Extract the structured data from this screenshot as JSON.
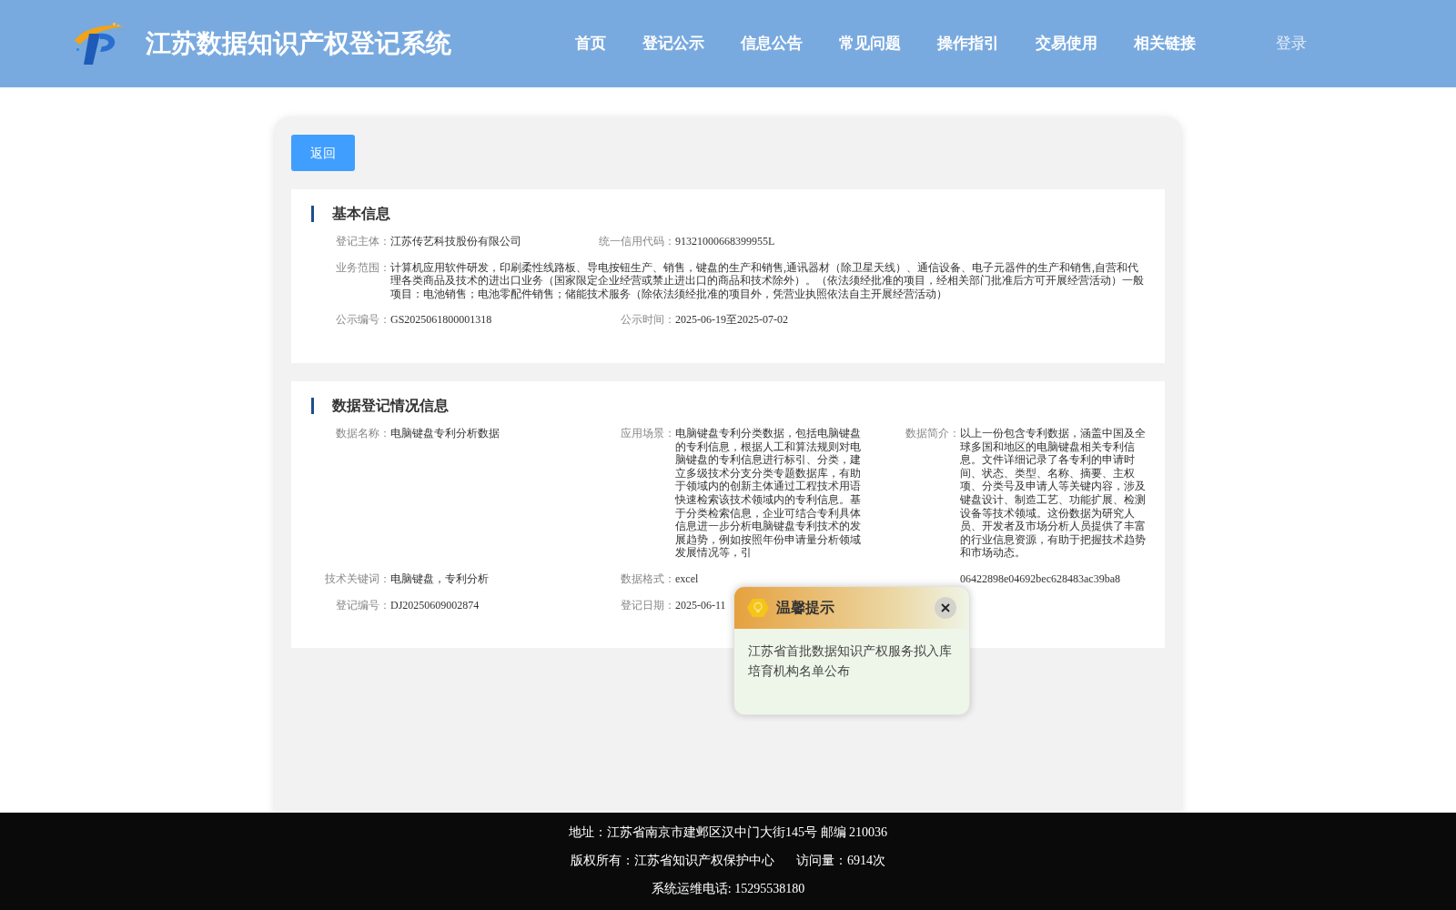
{
  "header": {
    "title": "江苏数据知识产权登记系统",
    "nav": [
      "首页",
      "登记公示",
      "信息公告",
      "常见问题",
      "操作指引",
      "交易使用",
      "相关链接"
    ],
    "login": "登录"
  },
  "back_button": "返回",
  "sections": [
    {
      "title": "基本信息",
      "rows": [
        [
          {
            "label": "登记主体：",
            "value": "江苏传艺科技股份有限公司"
          },
          {
            "label": "统一信用代码：",
            "value": "91321000668399955L"
          }
        ],
        [
          {
            "label": "业务范围：",
            "value": "计算机应用软件研发，印刷柔性线路板、导电按钮生产、销售，键盘的生产和销售,通讯器材（除卫星天线）、通信设备、电子元器件的生产和销售,自营和代理各类商品及技术的进出口业务（国家限定企业经营或禁止进出口的商品和技术除外）。（依法须经批准的项目，经相关部门批准后方可开展经营活动）一般项目：电池销售；电池零配件销售；储能技术服务（除依法须经批准的项目外，凭营业执照依法自主开展经营活动）"
          }
        ],
        [
          {
            "label": "公示编号：",
            "value": "GS2025061800001318"
          },
          {
            "label": "公示时间：",
            "value": "2025-06-19至2025-07-02"
          }
        ]
      ]
    },
    {
      "title": "数据登记情况信息",
      "rows": [
        [
          {
            "label": "数据名称：",
            "value": "电脑键盘专利分析数据"
          },
          {
            "label": "应用场景：",
            "value": "电脑键盘专利分类数据，包括电脑键盘的专利信息，根据人工和算法规则对电脑键盘的专利信息进行标引、分类，建立多级技术分支分类专题数据库，有助于领域内的创新主体通过工程技术用语快速检索该技术领域内的专利信息。基于分类检索信息，企业可结合专利具体信息进一步分析电脑键盘专利技术的发展趋势，例如按照年份申请量分析领域发展情况等，引"
          },
          {
            "label": "数据简介：",
            "value": "以上一份包含专利数据，涵盖中国及全球多国和地区的电脑键盘相关专利信息。文件详细记录了各专利的申请时间、状态、类型、名称、摘要、主权项、分类号及申请人等关键内容，涉及键盘设计、制造工艺、功能扩展、检测设备等技术领域。这份数据为研究人员、开发者及市场分析人员提供了丰富的行业信息资源，有助于把握技术趋势和市场动态。"
          }
        ],
        [
          {
            "label": "技术关键词：",
            "value": "电脑键盘，专利分析"
          },
          {
            "label": "数据格式：",
            "value": "excel"
          },
          {
            "value": "06422898e04692bec628483ac39ba8"
          }
        ],
        [
          {
            "label": "登记编号：",
            "value": "DJ20250609002874"
          },
          {
            "label": "登记日期：",
            "value": "2025-06-11"
          }
        ]
      ]
    }
  ],
  "popup": {
    "title": "温馨提示",
    "message": "江苏省首批数据知识产权服务拟入库培育机构名单公布"
  },
  "footer": {
    "lines": [
      [
        "地址：江苏省南京市建邺区汉中门大街145号 邮编 210036"
      ],
      [
        "版权所有：江苏省知识产权保护中心",
        "访问量：6914次"
      ],
      [
        "系统运维电话: 15295538180"
      ]
    ]
  }
}
